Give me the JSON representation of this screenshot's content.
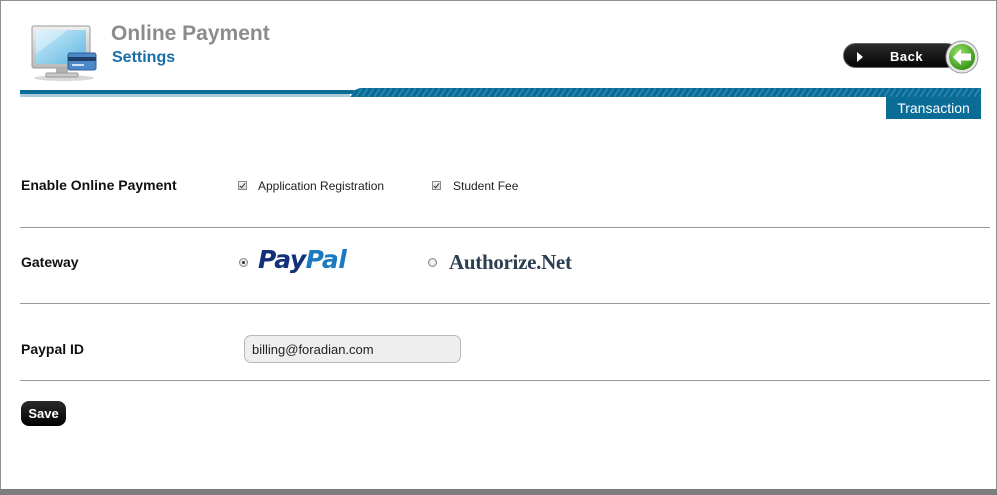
{
  "header": {
    "title": "Online Payment",
    "subtitle": "Settings",
    "back_label": "Back",
    "tab_label": "Transaction"
  },
  "colors": {
    "accent_blue": "#0b6c96",
    "subtitle_blue": "#1a6ea8",
    "title_gray": "#8c8c8c",
    "button_black": "#111111",
    "back_arrow_green": "#4caf23"
  },
  "icons": {
    "app": "computer-monitor-card-icon",
    "back": "left-arrow-icon",
    "back_play": "play-triangle-icon"
  },
  "form": {
    "enable_online_payment": {
      "label": "Enable Online Payment",
      "options": [
        {
          "label": "Application Registration",
          "checked": true
        },
        {
          "label": "Student Fee",
          "checked": true
        }
      ]
    },
    "gateway": {
      "label": "Gateway",
      "options": [
        {
          "label": "PayPal",
          "label_part1": "Pay",
          "label_part2": "Pal",
          "selected": true
        },
        {
          "label": "Authorize.Net",
          "selected": false
        }
      ]
    },
    "paypal_id": {
      "label": "Paypal ID",
      "value": "billing@foradian.com"
    },
    "save_label": "Save"
  }
}
